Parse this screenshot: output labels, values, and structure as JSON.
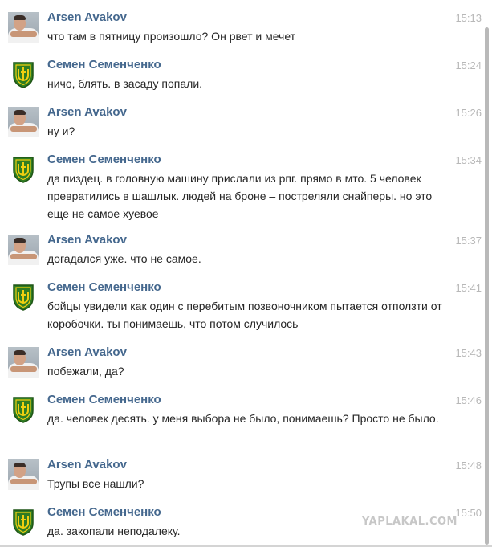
{
  "messages": [
    {
      "author": "Arsen Avakov",
      "avatar": "person-photo-avatar",
      "time": "15:13",
      "text": "что там в пятницу произошло? Он рвет и мечет"
    },
    {
      "author": "Семен Семенченко",
      "avatar": "shield-emblem-avatar",
      "time": "15:24",
      "text": "ничо, блять. в засаду попали."
    },
    {
      "author": "Arsen Avakov",
      "avatar": "person-photo-avatar",
      "time": "15:26",
      "text": "ну и?"
    },
    {
      "author": "Семен Семенченко",
      "avatar": "shield-emblem-avatar",
      "time": "15:34",
      "text": "да пиздец. в головную машину прислали из рпг. прямо в мто. 5 человек превратились в шашлык. людей на броне – постреляли снайперы. но это еще не самое хуевое"
    },
    {
      "author": "Arsen Avakov",
      "avatar": "person-photo-avatar",
      "time": "15:37",
      "text": "догадался уже. что не самое."
    },
    {
      "author": "Семен Семенченко",
      "avatar": "shield-emblem-avatar",
      "time": "15:41",
      "text": "бойцы увидели как один с перебитым позвоночником пытается отползти от коробочки. ты понимаешь, что потом случилось"
    },
    {
      "author": "Arsen Avakov",
      "avatar": "person-photo-avatar",
      "time": "15:43",
      "text": "побежали, да?"
    },
    {
      "author": "Семен Семенченко",
      "avatar": "shield-emblem-avatar",
      "time": "15:46",
      "text": "да. человек десять. у меня выбора не было, понимаешь? Просто не было."
    },
    {
      "author": "Arsen Avakov",
      "avatar": "person-photo-avatar",
      "time": "15:48",
      "text": "Трупы все нашли?"
    },
    {
      "author": "Семен Семенченко",
      "avatar": "shield-emblem-avatar",
      "time": "15:50",
      "text": "да. закопали неподалеку."
    }
  ],
  "watermark": "YAPLAKAL.COM",
  "colors": {
    "author": "#45688e",
    "time": "#b8b8b8",
    "text": "#262626",
    "shield_green": "#2f7d22",
    "shield_yellow": "#f0cf10"
  }
}
